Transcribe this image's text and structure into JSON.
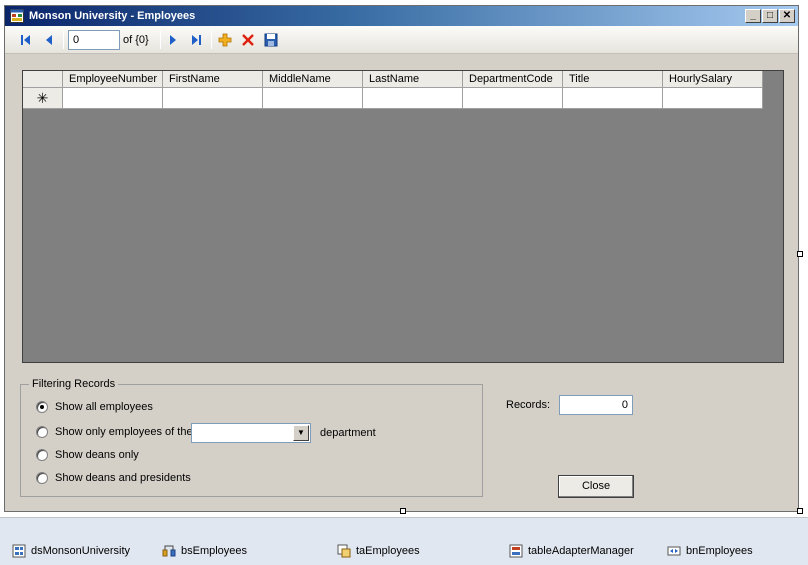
{
  "window": {
    "title": "Monson University - Employees"
  },
  "window_buttons": {
    "minimize": "_",
    "maximize": "□",
    "close": "✕"
  },
  "navigator": {
    "position": "0",
    "count_label": "of {0}"
  },
  "grid": {
    "columns": [
      "EmployeeNumber",
      "FirstName",
      "MiddleName",
      "LastName",
      "DepartmentCode",
      "Title",
      "HourlySalary"
    ],
    "new_row_marker": "✳"
  },
  "filter": {
    "legend": "Filtering Records",
    "options": [
      "Show all employees",
      "Show only employees of the",
      "Show deans only",
      "Show deans and presidents"
    ],
    "selected_index": 0,
    "department_suffix": "department",
    "department_value": ""
  },
  "records": {
    "label": "Records:",
    "value": "0"
  },
  "close_button": {
    "label": "Close"
  },
  "tray": [
    {
      "label": "dsMonsonUniversity",
      "icon": "dataset-icon"
    },
    {
      "label": "bsEmployees",
      "icon": "binding-source-icon"
    },
    {
      "label": "taEmployees",
      "icon": "table-adapter-icon"
    },
    {
      "label": "tableAdapterManager",
      "icon": "table-adapter-manager-icon"
    },
    {
      "label": "bnEmployees",
      "icon": "binding-navigator-icon"
    }
  ]
}
